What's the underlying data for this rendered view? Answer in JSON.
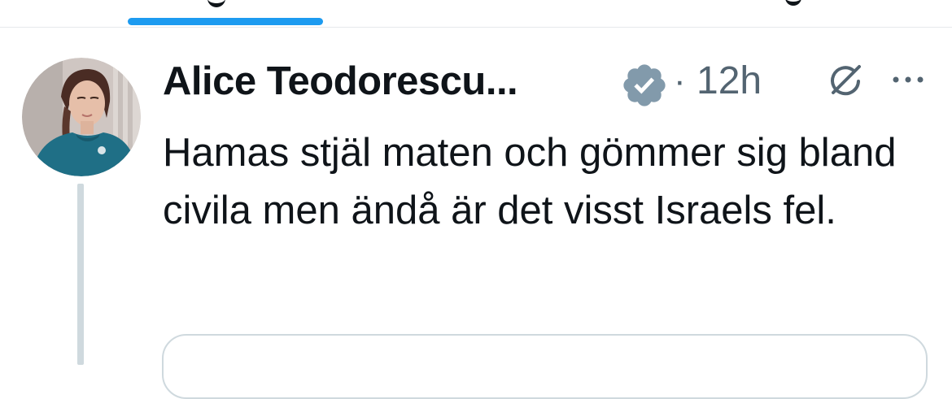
{
  "tweet": {
    "author_name": "Alice Teodorescu...",
    "separator": "·",
    "timestamp": "12h",
    "text": "Hamas stjäl maten och gömmer sig bland civila men ändå är det visst Israels fel."
  },
  "icons": {
    "verified": "verified-badge-icon",
    "grok": "grok-icon",
    "more": "more-options-icon"
  },
  "colors": {
    "accent": "#1d9bf0",
    "verified_badge": "#829aab",
    "secondary_text": "#536471",
    "thread_line": "#cfd9de"
  }
}
